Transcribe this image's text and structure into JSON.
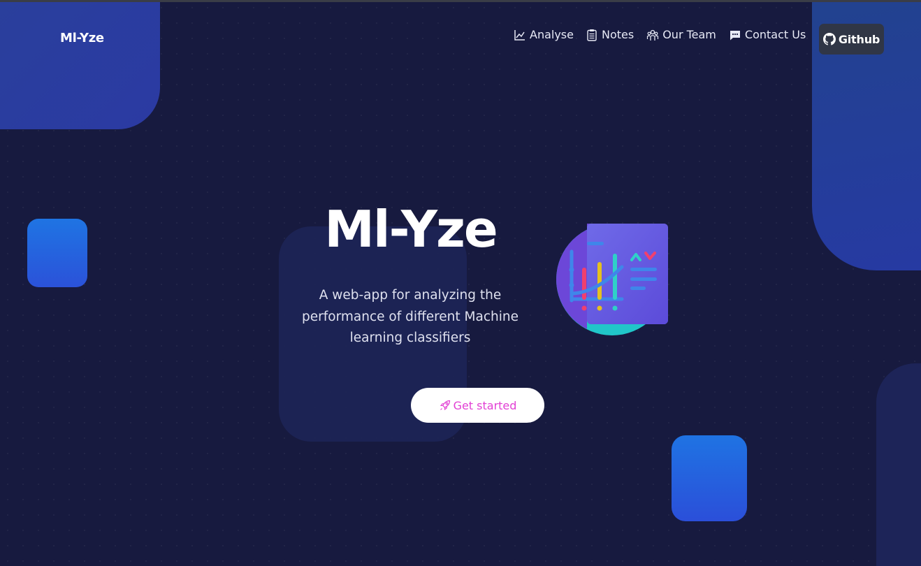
{
  "brand": {
    "name": "Ml-Yze"
  },
  "nav": {
    "items": [
      {
        "label": "Analyse",
        "icon": "chart-line-icon"
      },
      {
        "label": "Notes",
        "icon": "clipboard-icon"
      },
      {
        "label": "Our Team",
        "icon": "team-icon"
      },
      {
        "label": "Contact Us",
        "icon": "chat-icon"
      }
    ],
    "github": {
      "label": "Github",
      "icon": "github-icon"
    }
  },
  "hero": {
    "title": "Ml-Yze",
    "subtitle_lines": [
      "A web-app for analyzing the",
      "performance of different Machine",
      "learning classifiers"
    ],
    "cta": {
      "label": "Get started",
      "icon": "rocket-icon"
    }
  },
  "colors": {
    "background": "#171a3f",
    "accent_blue": "#1f74e3",
    "cta_text": "#e23fd4",
    "github_button": "#303646"
  }
}
